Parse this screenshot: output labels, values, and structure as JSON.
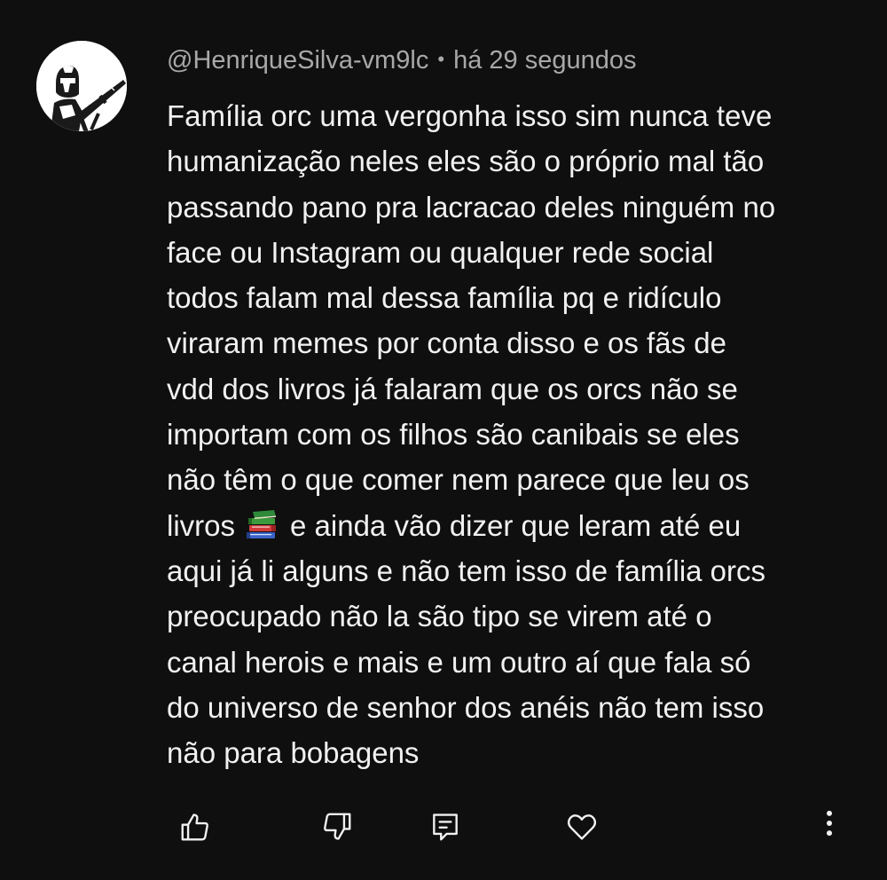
{
  "comment": {
    "avatar_icon": "clone-trooper-avatar",
    "author": "@HenriqueSilva-vm9lc",
    "separator": "•",
    "timestamp": "há 29 segundos",
    "lines": [
      "Família orc uma vergonha isso sim nunca teve",
      "humanização neles eles são o próprio mal tão",
      "passando pano pra lacracao deles ninguém no",
      "face ou Instagram ou qualquer rede social",
      "todos falam mal dessa família pq e ridículo",
      "viraram memes por conta disso e os fãs de",
      "vdd dos livros já falaram que os orcs não se",
      "importam com os filhos são canibais se eles",
      "não têm o que comer nem parece que leu os",
      "livros",
      "e ainda vão dizer que leram até eu",
      "aqui já li alguns e não tem isso de família orcs",
      "preocupado não la são tipo se virem até o",
      "canal herois e mais e um outro aí que fala só",
      "do universo de senhor dos anéis não tem isso",
      "não para bobagens"
    ],
    "emoji": "books-emoji"
  },
  "actions": {
    "like_icon": "thumbs-up-icon",
    "dislike_icon": "thumbs-down-icon",
    "reply_icon": "reply-comment-icon",
    "heart_icon": "heart-icon",
    "more_icon": "more-vertical-icon"
  },
  "colors": {
    "background": "#0f0f0f",
    "text": "#f1f1f1",
    "meta": "#a8a8a8"
  }
}
